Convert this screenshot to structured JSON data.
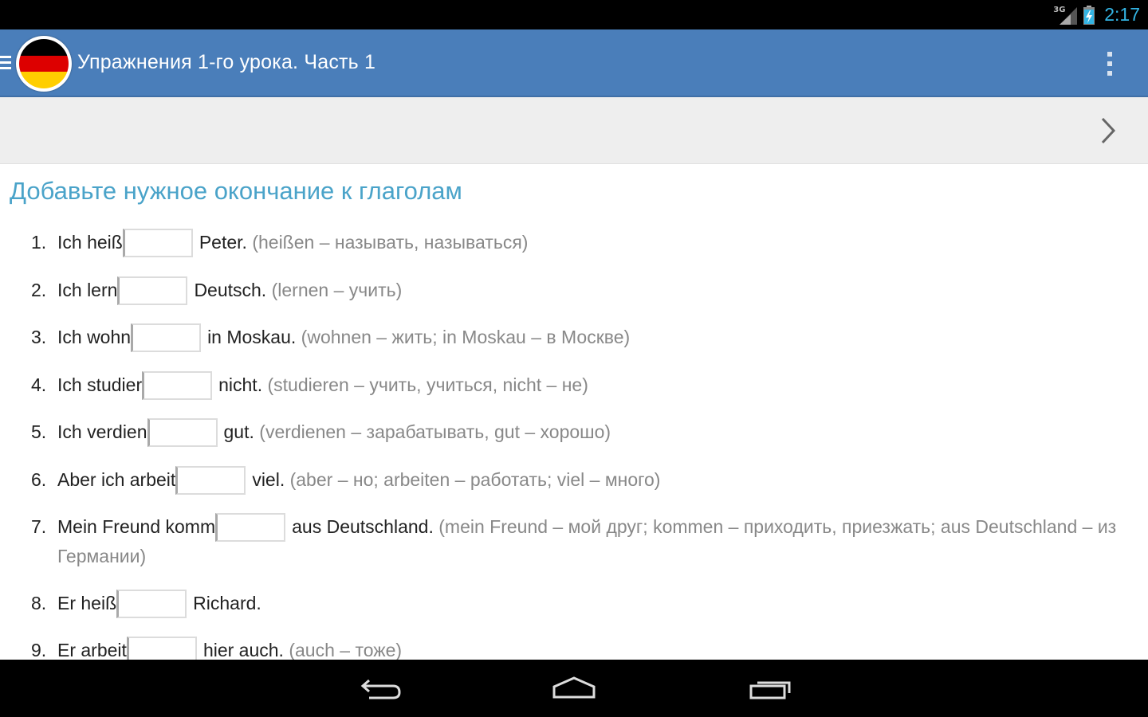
{
  "status_bar": {
    "network": "3G",
    "time": "2:17",
    "icons": [
      "signal-icon",
      "battery-charging-icon"
    ]
  },
  "action_bar": {
    "title": "Упражнения 1-го урока. Часть 1",
    "icons": [
      "drawer-icon",
      "german-flag-logo",
      "overflow-menu-icon"
    ]
  },
  "navigation": {
    "next_icon": "chevron-right-icon"
  },
  "exercise": {
    "heading": "Добавьте нужное окончание к глаголам",
    "items": [
      {
        "num": "1.",
        "before": "Ich heiß",
        "after": "Peter.",
        "hint": "(heißen – называть, называться)"
      },
      {
        "num": "2.",
        "before": "Ich lern",
        "after": "Deutsch.",
        "hint": "(lernen – учить)"
      },
      {
        "num": "3.",
        "before": "Ich wohn",
        "after": "in Moskau.",
        "hint": "(wohnen – жить; in Moskau – в Москве)"
      },
      {
        "num": "4.",
        "before": "Ich studier",
        "after": "nicht.",
        "hint": "(studieren – учить, учиться, nicht – не)"
      },
      {
        "num": "5.",
        "before": "Ich verdien",
        "after": "gut.",
        "hint": "(verdienen – зарабатывать, gut – хорошо)"
      },
      {
        "num": "6.",
        "before": "Aber ich arbeit",
        "after": "viel.",
        "hint": "(aber – но; arbeiten – работать; viel – много)"
      },
      {
        "num": "7.",
        "before": "Mein Freund komm",
        "after": "aus Deutschland.",
        "hint": "(mein Freund – мой друг; kommen – приходить, приезжать; aus Deutschland – из Германии)"
      },
      {
        "num": "8.",
        "before": "Er heiß",
        "after": "Richard.",
        "hint": ""
      },
      {
        "num": "9.",
        "before": "Er arbeit",
        "after": "hier auch.",
        "hint": "(auch – тоже)"
      }
    ]
  },
  "colors": {
    "action_bar": "#4a7eba",
    "heading": "#4aa3c9",
    "clock": "#33b5e5",
    "hint": "#888888",
    "flag": [
      "#000000",
      "#dd0000",
      "#ffce00"
    ]
  },
  "system_nav": {
    "icons": [
      "back-icon",
      "home-icon",
      "recent-apps-icon"
    ]
  }
}
